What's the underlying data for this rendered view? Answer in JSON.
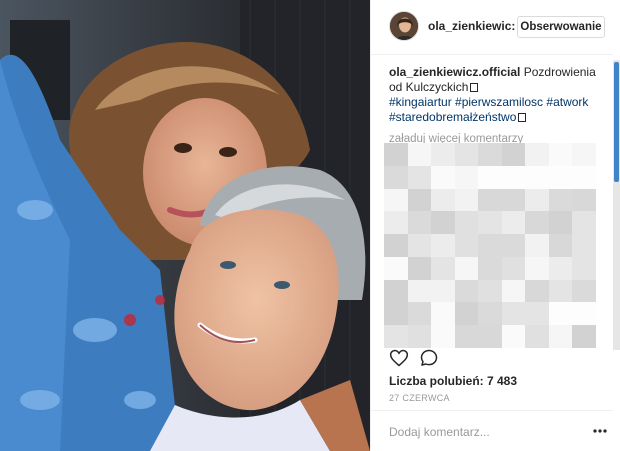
{
  "post": {
    "photo_description_icon": "selfie-photo",
    "header": {
      "username": "ola_zienkiewic:",
      "follow_label": "Obserwowanie"
    },
    "caption": {
      "username": "ola_zienkiewicz.official",
      "text": "Pozdrowienia od Kulczyckich",
      "hashtags": "#kingaiartur #pierwszamilosc #atwork #staredobremałżeństwo"
    },
    "load_more_label": "załaduj więcej komentarzy",
    "likes_label": "Liczba polubień: 7 483",
    "date_label": "27 CZERWCA",
    "comment_placeholder": "Dodaj komentarz...",
    "icons": {
      "like": "heart-outline-icon",
      "comment": "speech-bubble-icon",
      "more": "ellipsis-icon"
    },
    "colors": {
      "hashtag": "#003569",
      "muted": "#999999",
      "scroll_thumb": "#3f84c9"
    }
  }
}
